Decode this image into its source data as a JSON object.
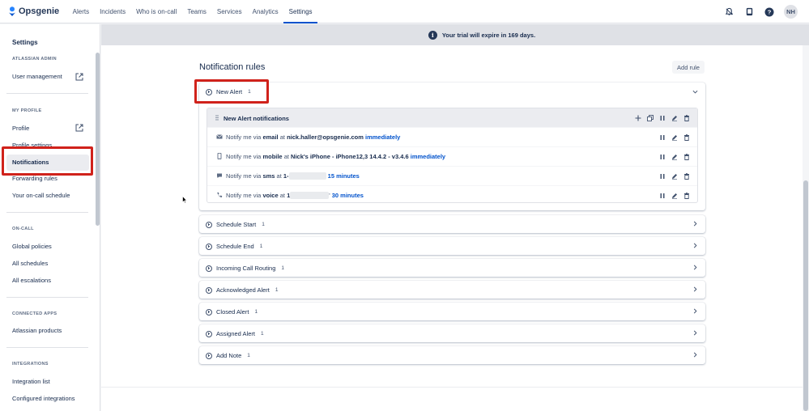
{
  "topnav": {
    "brand": "Opsgenie",
    "items": [
      {
        "label": "Alerts",
        "active": false
      },
      {
        "label": "Incidents",
        "active": false
      },
      {
        "label": "Who is on-call",
        "active": false
      },
      {
        "label": "Teams",
        "active": false
      },
      {
        "label": "Services",
        "active": false
      },
      {
        "label": "Analytics",
        "active": false
      },
      {
        "label": "Settings",
        "active": true
      }
    ],
    "avatar_initials": "NH",
    "icons": [
      "notification-bell-icon",
      "phone-icon",
      "help-icon"
    ]
  },
  "banner": {
    "text": "Your trial will expire in 169 days.",
    "icon": "info-icon"
  },
  "sidebar": {
    "title": "Settings",
    "sections": [
      {
        "heading": "ATLASSIAN ADMIN",
        "items": [
          {
            "label": "User management",
            "external": true
          }
        ]
      },
      {
        "heading": "MY PROFILE",
        "items": [
          {
            "label": "Profile",
            "external": true
          },
          {
            "label": "Profile settings"
          },
          {
            "label": "Notifications",
            "active": true
          },
          {
            "label": "Forwarding rules"
          },
          {
            "label": "Your on-call schedule"
          }
        ]
      },
      {
        "heading": "ON-CALL",
        "items": [
          {
            "label": "Global policies"
          },
          {
            "label": "All schedules"
          },
          {
            "label": "All escalations"
          }
        ]
      },
      {
        "heading": "CONNECTED APPS",
        "items": [
          {
            "label": "Atlassian products"
          }
        ]
      },
      {
        "heading": "INTEGRATIONS",
        "items": [
          {
            "label": "Integration list"
          },
          {
            "label": "Configured integrations"
          }
        ]
      }
    ]
  },
  "main": {
    "title": "Notification rules",
    "add_rule_label": "Add rule",
    "expanded_rule": {
      "name": "New Alert",
      "count": "1",
      "sub_title": "New Alert notifications",
      "notifications": [
        {
          "icon": "email-icon",
          "prefix": "Notify me via ",
          "method": "email",
          "at": " at ",
          "target": "nick.haller@opsgenie.com",
          "gap": " ",
          "timing": "immediately",
          "redacted": false
        },
        {
          "icon": "mobile-icon",
          "prefix": "Notify me via ",
          "method": "mobile",
          "at": " at ",
          "target": "Nick's iPhone - iPhone12,3 14.4.2 - v3.4.6",
          "gap": " ",
          "timing": "immediately",
          "redacted": false
        },
        {
          "icon": "sms-icon",
          "prefix": "Notify me via ",
          "method": "sms",
          "at": " at ",
          "target": "1-",
          "gap": " ",
          "timing": "15 minutes",
          "redacted": true
        },
        {
          "icon": "phone-icon",
          "prefix": "Notify me via ",
          "method": "voice",
          "at": " at ",
          "target": "1",
          "gap": "' ",
          "timing": "30 minutes",
          "redacted": true
        }
      ]
    },
    "rules": [
      {
        "name": "Schedule Start",
        "count": "1"
      },
      {
        "name": "Schedule End",
        "count": "1"
      },
      {
        "name": "Incoming Call Routing",
        "count": "1"
      },
      {
        "name": "Acknowledged Alert",
        "count": "1"
      },
      {
        "name": "Closed Alert",
        "count": "1"
      },
      {
        "name": "Assigned Alert",
        "count": "1"
      },
      {
        "name": "Add Note",
        "count": "1"
      }
    ]
  },
  "colors": {
    "accent": "#0052cc",
    "highlight": "#d0221b",
    "text": "#172b4d",
    "muted": "#42526e"
  }
}
